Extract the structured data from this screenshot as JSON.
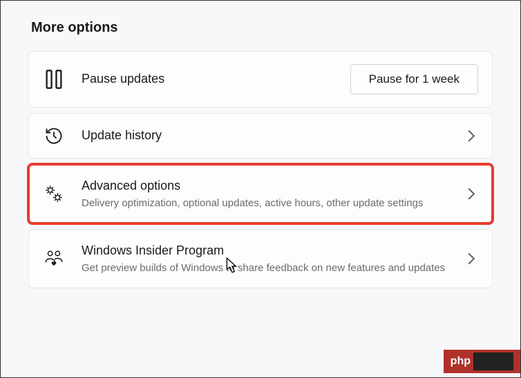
{
  "section_title": "More options",
  "options": {
    "pause": {
      "title": "Pause updates",
      "button_label": "Pause for 1 week"
    },
    "history": {
      "title": "Update history"
    },
    "advanced": {
      "title": "Advanced options",
      "subtitle": "Delivery optimization, optional updates, active hours, other update settings"
    },
    "insider": {
      "title": "Windows Insider Program",
      "subtitle": "Get preview builds of Windows to share feedback on new features and updates"
    }
  },
  "watermark_text": "php"
}
